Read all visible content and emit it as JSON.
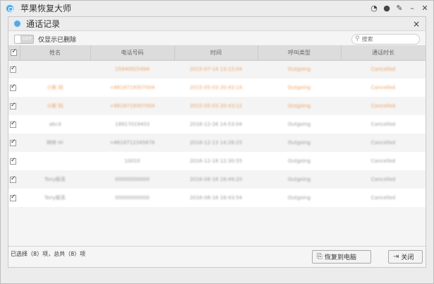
{
  "app": {
    "title": "苹果恢复大师"
  },
  "dialog": {
    "title": "通话记录",
    "close_symbol": "×"
  },
  "toolbar": {
    "toggle_text": "OFF",
    "filter_label": "仅显示已删除",
    "search_placeholder": "搜索"
  },
  "table": {
    "headers": [
      "",
      "姓名",
      "电话号码",
      "时间",
      "呼叫类型",
      "通话时长"
    ],
    "rows": [
      {
        "checked": true,
        "highlight": true,
        "name": "",
        "phone": "15940925494",
        "time": "2015-07-14 13:15:04",
        "type": "Outgoing",
        "duration": "Cancelled"
      },
      {
        "checked": true,
        "highlight": true,
        "name": "小新 妈",
        "phone": "+8618719307004",
        "time": "2015-05-03 20:43:14",
        "type": "Outgoing",
        "duration": "Cancelled"
      },
      {
        "checked": true,
        "highlight": true,
        "name": "小新 妈",
        "phone": "+8618719307004",
        "time": "2015-05-03 20:43:12",
        "type": "Outgoing",
        "duration": "Cancelled"
      },
      {
        "checked": true,
        "highlight": false,
        "name": "abcd",
        "phone": "18917019453",
        "time": "2016-12-26 14:53:04",
        "type": "Outgoing",
        "duration": "Cancelled"
      },
      {
        "checked": true,
        "highlight": false,
        "name": "林林 Hr",
        "phone": "+8618712345678",
        "time": "2016-12-13 14:26:25",
        "type": "Outgoing",
        "duration": "Cancelled"
      },
      {
        "checked": true,
        "highlight": false,
        "name": "",
        "phone": "10010",
        "time": "2016-12-18 12:30:55",
        "type": "Outgoing",
        "duration": "Cancelled"
      },
      {
        "checked": true,
        "highlight": false,
        "name": "Tony联系",
        "phone": "00000000000",
        "time": "2016-08-16 18:49:20",
        "type": "Outgoing",
        "duration": "Cancelled"
      },
      {
        "checked": true,
        "highlight": false,
        "name": "Tony联系",
        "phone": "00000000000",
        "time": "2016-08-16 18:43:54",
        "type": "Outgoing",
        "duration": "Cancelled"
      }
    ]
  },
  "footer": {
    "status": "已选择（8）项，总共（8）项",
    "restore_label": "恢复到电脑",
    "close_label": "关闭"
  },
  "colors": {
    "highlight": "#f0a060",
    "header_bg": "#dcdcdc"
  }
}
